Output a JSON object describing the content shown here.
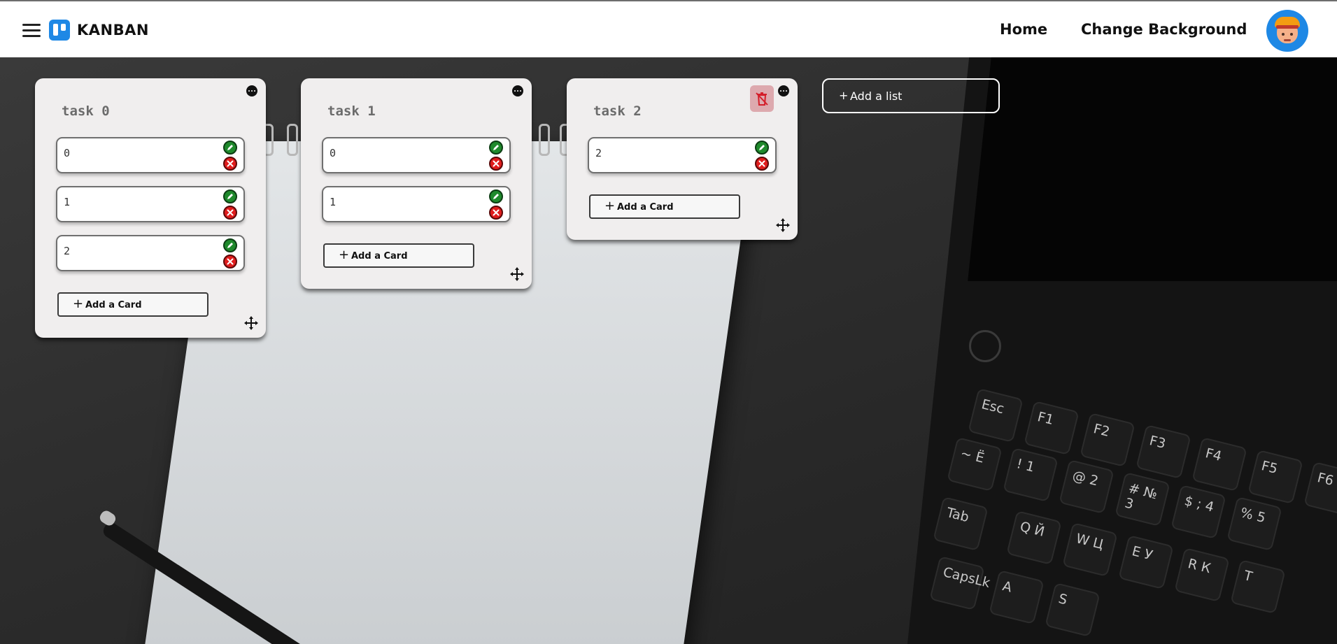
{
  "header": {
    "brand": "KANBAN",
    "nav": {
      "home": "Home",
      "change_background": "Change Background"
    }
  },
  "lists": [
    {
      "title": "task 0",
      "cards": [
        "0",
        "1",
        "2"
      ],
      "add_card_label": "Add a Card"
    },
    {
      "title": "task 1",
      "cards": [
        "0",
        "1"
      ],
      "add_card_label": "Add a Card"
    },
    {
      "title": "task 2",
      "cards": [
        "2"
      ],
      "add_card_label": "Add a Card",
      "delete_icon_visible": true
    }
  ],
  "add_list_label": "Add a list",
  "background": {
    "keyboard_keys": [
      "Esc",
      "F1",
      "F2",
      "F3",
      "F4",
      "F5",
      "F6",
      "~ Ё",
      "! 1",
      "@ 2",
      "# № 3",
      "$ ; 4",
      "% 5",
      "Tab",
      "Q Й",
      "W Ц",
      "E У",
      "R К",
      "T",
      "CapsLk",
      "A",
      "S"
    ]
  },
  "colors": {
    "edit": "#1f8a2c",
    "delete": "#e01d1d",
    "brand_blue": "#1e88e5"
  }
}
